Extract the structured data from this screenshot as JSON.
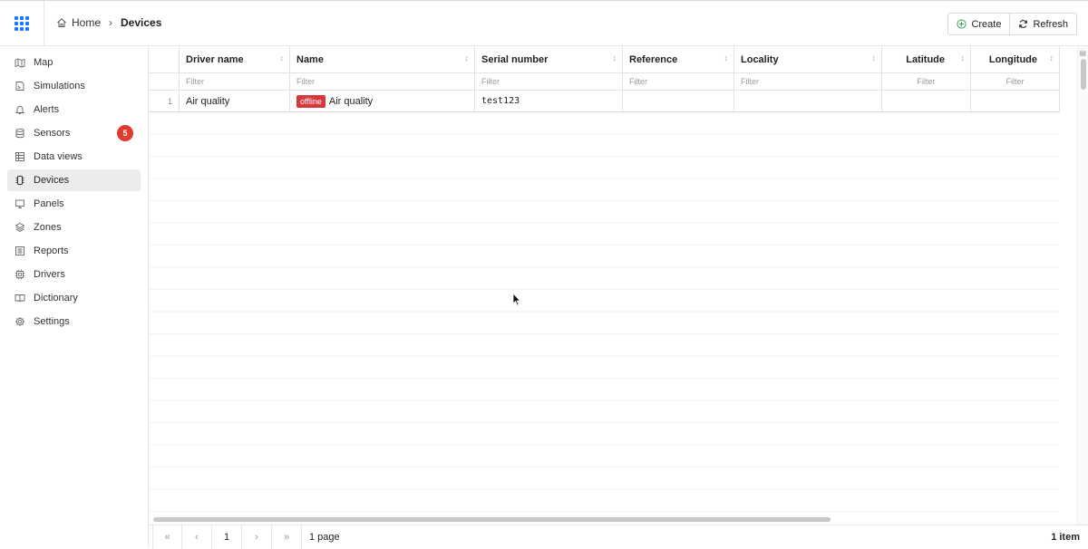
{
  "app": {
    "apps_icon": "apps-grid-icon",
    "accent_color": "#1677ff"
  },
  "breadcrumb": {
    "home_label": "Home",
    "current_label": "Devices"
  },
  "toolbar": {
    "create_label": "Create",
    "refresh_label": "Refresh"
  },
  "sidebar": {
    "items": [
      {
        "label": "Map",
        "icon": "map-icon"
      },
      {
        "label": "Simulations",
        "icon": "simulation-icon"
      },
      {
        "label": "Alerts",
        "icon": "bell-icon"
      },
      {
        "label": "Sensors",
        "icon": "database-icon",
        "badge": "5"
      },
      {
        "label": "Data views",
        "icon": "table-icon"
      },
      {
        "label": "Devices",
        "icon": "chip-icon",
        "active": true
      },
      {
        "label": "Panels",
        "icon": "monitor-icon"
      },
      {
        "label": "Zones",
        "icon": "layers-icon"
      },
      {
        "label": "Reports",
        "icon": "report-icon"
      },
      {
        "label": "Drivers",
        "icon": "cpu-icon"
      },
      {
        "label": "Dictionary",
        "icon": "book-icon"
      },
      {
        "label": "Settings",
        "icon": "gear-icon"
      }
    ]
  },
  "grid": {
    "columns": [
      "Driver name",
      "Name",
      "Serial number",
      "Reference",
      "Locality",
      "Latitude",
      "Longitude"
    ],
    "filter_placeholder": "Filter",
    "rows": [
      {
        "index": "1",
        "driver_name": "Air quality",
        "status": "offline",
        "name": "Air quality",
        "serial_number": "test123",
        "reference": "",
        "locality": "",
        "latitude": "",
        "longitude": ""
      }
    ]
  },
  "footer": {
    "current_page": "1",
    "pages_label": "1 page",
    "items_label": "1 item"
  }
}
